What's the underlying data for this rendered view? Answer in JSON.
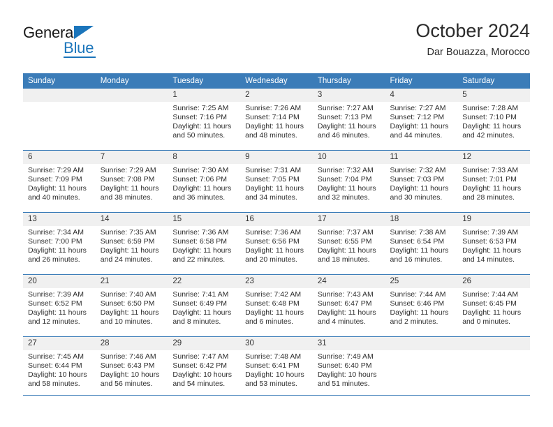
{
  "brand": {
    "name_top": "General",
    "name_bottom": "Blue",
    "accent_color": "#1b75bb"
  },
  "header": {
    "title": "October 2024",
    "subtitle": "Dar Bouazza, Morocco"
  },
  "theme": {
    "header_row_color": "#3b7cb8",
    "day_band_color": "#f0f0f0",
    "text_color": "#2e2e2e"
  },
  "weekday_headers": [
    "Sunday",
    "Monday",
    "Tuesday",
    "Wednesday",
    "Thursday",
    "Friday",
    "Saturday"
  ],
  "weeks": [
    [
      {
        "day": "",
        "sunrise": "",
        "sunset": "",
        "daylight": ""
      },
      {
        "day": "",
        "sunrise": "",
        "sunset": "",
        "daylight": ""
      },
      {
        "day": "1",
        "sunrise": "Sunrise: 7:25 AM",
        "sunset": "Sunset: 7:16 PM",
        "daylight": "Daylight: 11 hours and 50 minutes."
      },
      {
        "day": "2",
        "sunrise": "Sunrise: 7:26 AM",
        "sunset": "Sunset: 7:14 PM",
        "daylight": "Daylight: 11 hours and 48 minutes."
      },
      {
        "day": "3",
        "sunrise": "Sunrise: 7:27 AM",
        "sunset": "Sunset: 7:13 PM",
        "daylight": "Daylight: 11 hours and 46 minutes."
      },
      {
        "day": "4",
        "sunrise": "Sunrise: 7:27 AM",
        "sunset": "Sunset: 7:12 PM",
        "daylight": "Daylight: 11 hours and 44 minutes."
      },
      {
        "day": "5",
        "sunrise": "Sunrise: 7:28 AM",
        "sunset": "Sunset: 7:10 PM",
        "daylight": "Daylight: 11 hours and 42 minutes."
      }
    ],
    [
      {
        "day": "6",
        "sunrise": "Sunrise: 7:29 AM",
        "sunset": "Sunset: 7:09 PM",
        "daylight": "Daylight: 11 hours and 40 minutes."
      },
      {
        "day": "7",
        "sunrise": "Sunrise: 7:29 AM",
        "sunset": "Sunset: 7:08 PM",
        "daylight": "Daylight: 11 hours and 38 minutes."
      },
      {
        "day": "8",
        "sunrise": "Sunrise: 7:30 AM",
        "sunset": "Sunset: 7:06 PM",
        "daylight": "Daylight: 11 hours and 36 minutes."
      },
      {
        "day": "9",
        "sunrise": "Sunrise: 7:31 AM",
        "sunset": "Sunset: 7:05 PM",
        "daylight": "Daylight: 11 hours and 34 minutes."
      },
      {
        "day": "10",
        "sunrise": "Sunrise: 7:32 AM",
        "sunset": "Sunset: 7:04 PM",
        "daylight": "Daylight: 11 hours and 32 minutes."
      },
      {
        "day": "11",
        "sunrise": "Sunrise: 7:32 AM",
        "sunset": "Sunset: 7:03 PM",
        "daylight": "Daylight: 11 hours and 30 minutes."
      },
      {
        "day": "12",
        "sunrise": "Sunrise: 7:33 AM",
        "sunset": "Sunset: 7:01 PM",
        "daylight": "Daylight: 11 hours and 28 minutes."
      }
    ],
    [
      {
        "day": "13",
        "sunrise": "Sunrise: 7:34 AM",
        "sunset": "Sunset: 7:00 PM",
        "daylight": "Daylight: 11 hours and 26 minutes."
      },
      {
        "day": "14",
        "sunrise": "Sunrise: 7:35 AM",
        "sunset": "Sunset: 6:59 PM",
        "daylight": "Daylight: 11 hours and 24 minutes."
      },
      {
        "day": "15",
        "sunrise": "Sunrise: 7:36 AM",
        "sunset": "Sunset: 6:58 PM",
        "daylight": "Daylight: 11 hours and 22 minutes."
      },
      {
        "day": "16",
        "sunrise": "Sunrise: 7:36 AM",
        "sunset": "Sunset: 6:56 PM",
        "daylight": "Daylight: 11 hours and 20 minutes."
      },
      {
        "day": "17",
        "sunrise": "Sunrise: 7:37 AM",
        "sunset": "Sunset: 6:55 PM",
        "daylight": "Daylight: 11 hours and 18 minutes."
      },
      {
        "day": "18",
        "sunrise": "Sunrise: 7:38 AM",
        "sunset": "Sunset: 6:54 PM",
        "daylight": "Daylight: 11 hours and 16 minutes."
      },
      {
        "day": "19",
        "sunrise": "Sunrise: 7:39 AM",
        "sunset": "Sunset: 6:53 PM",
        "daylight": "Daylight: 11 hours and 14 minutes."
      }
    ],
    [
      {
        "day": "20",
        "sunrise": "Sunrise: 7:39 AM",
        "sunset": "Sunset: 6:52 PM",
        "daylight": "Daylight: 11 hours and 12 minutes."
      },
      {
        "day": "21",
        "sunrise": "Sunrise: 7:40 AM",
        "sunset": "Sunset: 6:50 PM",
        "daylight": "Daylight: 11 hours and 10 minutes."
      },
      {
        "day": "22",
        "sunrise": "Sunrise: 7:41 AM",
        "sunset": "Sunset: 6:49 PM",
        "daylight": "Daylight: 11 hours and 8 minutes."
      },
      {
        "day": "23",
        "sunrise": "Sunrise: 7:42 AM",
        "sunset": "Sunset: 6:48 PM",
        "daylight": "Daylight: 11 hours and 6 minutes."
      },
      {
        "day": "24",
        "sunrise": "Sunrise: 7:43 AM",
        "sunset": "Sunset: 6:47 PM",
        "daylight": "Daylight: 11 hours and 4 minutes."
      },
      {
        "day": "25",
        "sunrise": "Sunrise: 7:44 AM",
        "sunset": "Sunset: 6:46 PM",
        "daylight": "Daylight: 11 hours and 2 minutes."
      },
      {
        "day": "26",
        "sunrise": "Sunrise: 7:44 AM",
        "sunset": "Sunset: 6:45 PM",
        "daylight": "Daylight: 11 hours and 0 minutes."
      }
    ],
    [
      {
        "day": "27",
        "sunrise": "Sunrise: 7:45 AM",
        "sunset": "Sunset: 6:44 PM",
        "daylight": "Daylight: 10 hours and 58 minutes."
      },
      {
        "day": "28",
        "sunrise": "Sunrise: 7:46 AM",
        "sunset": "Sunset: 6:43 PM",
        "daylight": "Daylight: 10 hours and 56 minutes."
      },
      {
        "day": "29",
        "sunrise": "Sunrise: 7:47 AM",
        "sunset": "Sunset: 6:42 PM",
        "daylight": "Daylight: 10 hours and 54 minutes."
      },
      {
        "day": "30",
        "sunrise": "Sunrise: 7:48 AM",
        "sunset": "Sunset: 6:41 PM",
        "daylight": "Daylight: 10 hours and 53 minutes."
      },
      {
        "day": "31",
        "sunrise": "Sunrise: 7:49 AM",
        "sunset": "Sunset: 6:40 PM",
        "daylight": "Daylight: 10 hours and 51 minutes."
      },
      {
        "day": "",
        "sunrise": "",
        "sunset": "",
        "daylight": ""
      },
      {
        "day": "",
        "sunrise": "",
        "sunset": "",
        "daylight": ""
      }
    ]
  ]
}
